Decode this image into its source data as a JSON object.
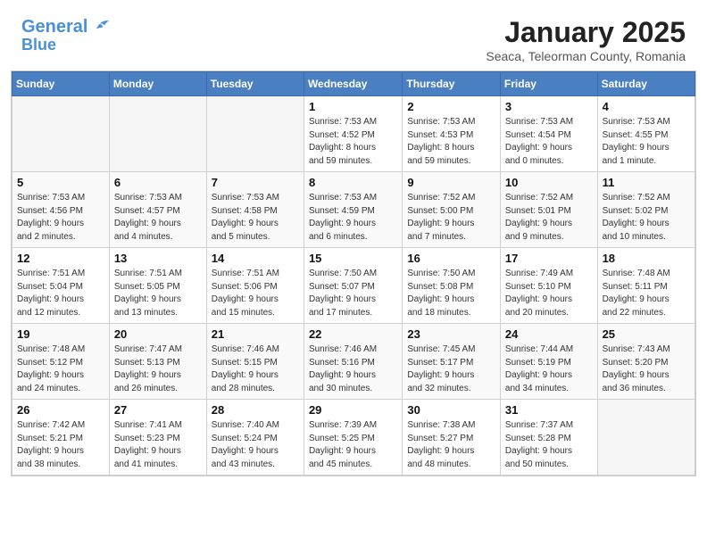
{
  "header": {
    "logo_line1": "General",
    "logo_line2": "Blue",
    "month": "January 2025",
    "location": "Seaca, Teleorman County, Romania"
  },
  "weekdays": [
    "Sunday",
    "Monday",
    "Tuesday",
    "Wednesday",
    "Thursday",
    "Friday",
    "Saturday"
  ],
  "weeks": [
    [
      {
        "day": "",
        "info": ""
      },
      {
        "day": "",
        "info": ""
      },
      {
        "day": "",
        "info": ""
      },
      {
        "day": "1",
        "info": "Sunrise: 7:53 AM\nSunset: 4:52 PM\nDaylight: 8 hours\nand 59 minutes."
      },
      {
        "day": "2",
        "info": "Sunrise: 7:53 AM\nSunset: 4:53 PM\nDaylight: 8 hours\nand 59 minutes."
      },
      {
        "day": "3",
        "info": "Sunrise: 7:53 AM\nSunset: 4:54 PM\nDaylight: 9 hours\nand 0 minutes."
      },
      {
        "day": "4",
        "info": "Sunrise: 7:53 AM\nSunset: 4:55 PM\nDaylight: 9 hours\nand 1 minute."
      }
    ],
    [
      {
        "day": "5",
        "info": "Sunrise: 7:53 AM\nSunset: 4:56 PM\nDaylight: 9 hours\nand 2 minutes."
      },
      {
        "day": "6",
        "info": "Sunrise: 7:53 AM\nSunset: 4:57 PM\nDaylight: 9 hours\nand 4 minutes."
      },
      {
        "day": "7",
        "info": "Sunrise: 7:53 AM\nSunset: 4:58 PM\nDaylight: 9 hours\nand 5 minutes."
      },
      {
        "day": "8",
        "info": "Sunrise: 7:53 AM\nSunset: 4:59 PM\nDaylight: 9 hours\nand 6 minutes."
      },
      {
        "day": "9",
        "info": "Sunrise: 7:52 AM\nSunset: 5:00 PM\nDaylight: 9 hours\nand 7 minutes."
      },
      {
        "day": "10",
        "info": "Sunrise: 7:52 AM\nSunset: 5:01 PM\nDaylight: 9 hours\nand 9 minutes."
      },
      {
        "day": "11",
        "info": "Sunrise: 7:52 AM\nSunset: 5:02 PM\nDaylight: 9 hours\nand 10 minutes."
      }
    ],
    [
      {
        "day": "12",
        "info": "Sunrise: 7:51 AM\nSunset: 5:04 PM\nDaylight: 9 hours\nand 12 minutes."
      },
      {
        "day": "13",
        "info": "Sunrise: 7:51 AM\nSunset: 5:05 PM\nDaylight: 9 hours\nand 13 minutes."
      },
      {
        "day": "14",
        "info": "Sunrise: 7:51 AM\nSunset: 5:06 PM\nDaylight: 9 hours\nand 15 minutes."
      },
      {
        "day": "15",
        "info": "Sunrise: 7:50 AM\nSunset: 5:07 PM\nDaylight: 9 hours\nand 17 minutes."
      },
      {
        "day": "16",
        "info": "Sunrise: 7:50 AM\nSunset: 5:08 PM\nDaylight: 9 hours\nand 18 minutes."
      },
      {
        "day": "17",
        "info": "Sunrise: 7:49 AM\nSunset: 5:10 PM\nDaylight: 9 hours\nand 20 minutes."
      },
      {
        "day": "18",
        "info": "Sunrise: 7:48 AM\nSunset: 5:11 PM\nDaylight: 9 hours\nand 22 minutes."
      }
    ],
    [
      {
        "day": "19",
        "info": "Sunrise: 7:48 AM\nSunset: 5:12 PM\nDaylight: 9 hours\nand 24 minutes."
      },
      {
        "day": "20",
        "info": "Sunrise: 7:47 AM\nSunset: 5:13 PM\nDaylight: 9 hours\nand 26 minutes."
      },
      {
        "day": "21",
        "info": "Sunrise: 7:46 AM\nSunset: 5:15 PM\nDaylight: 9 hours\nand 28 minutes."
      },
      {
        "day": "22",
        "info": "Sunrise: 7:46 AM\nSunset: 5:16 PM\nDaylight: 9 hours\nand 30 minutes."
      },
      {
        "day": "23",
        "info": "Sunrise: 7:45 AM\nSunset: 5:17 PM\nDaylight: 9 hours\nand 32 minutes."
      },
      {
        "day": "24",
        "info": "Sunrise: 7:44 AM\nSunset: 5:19 PM\nDaylight: 9 hours\nand 34 minutes."
      },
      {
        "day": "25",
        "info": "Sunrise: 7:43 AM\nSunset: 5:20 PM\nDaylight: 9 hours\nand 36 minutes."
      }
    ],
    [
      {
        "day": "26",
        "info": "Sunrise: 7:42 AM\nSunset: 5:21 PM\nDaylight: 9 hours\nand 38 minutes."
      },
      {
        "day": "27",
        "info": "Sunrise: 7:41 AM\nSunset: 5:23 PM\nDaylight: 9 hours\nand 41 minutes."
      },
      {
        "day": "28",
        "info": "Sunrise: 7:40 AM\nSunset: 5:24 PM\nDaylight: 9 hours\nand 43 minutes."
      },
      {
        "day": "29",
        "info": "Sunrise: 7:39 AM\nSunset: 5:25 PM\nDaylight: 9 hours\nand 45 minutes."
      },
      {
        "day": "30",
        "info": "Sunrise: 7:38 AM\nSunset: 5:27 PM\nDaylight: 9 hours\nand 48 minutes."
      },
      {
        "day": "31",
        "info": "Sunrise: 7:37 AM\nSunset: 5:28 PM\nDaylight: 9 hours\nand 50 minutes."
      },
      {
        "day": "",
        "info": ""
      }
    ]
  ]
}
